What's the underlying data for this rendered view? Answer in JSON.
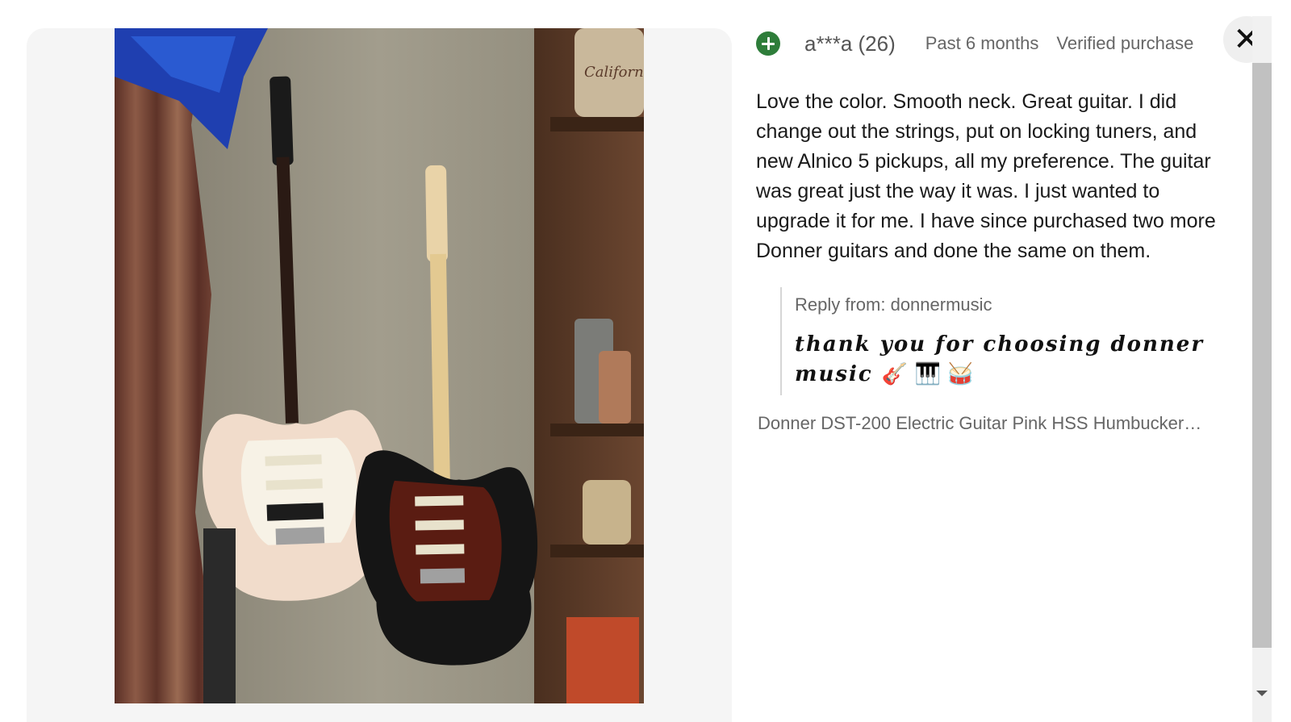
{
  "review": {
    "reviewer": "a***a (26)",
    "time": "Past 6 months",
    "verified": "Verified purchase",
    "text": "Love the color. Smooth neck. Great guitar. I did change out the strings, put on locking tuners, and new Alnico 5 pickups, all my preference. The guitar was great just the way it was. I just wanted to upgrade it for me. I have since purchased two more Donner guitars and done the same on them.",
    "reply_label": "Reply from: donnermusic",
    "reply_text": "thank you for choosing donner music",
    "reply_emojis": "🎸 🎹 🥁",
    "product": "Donner DST-200 Electric Guitar Pink HSS Humbucker…"
  },
  "photo": {
    "description_icon": "review-photo",
    "sign_text": "California"
  },
  "controls": {
    "close_label": "✕"
  },
  "colors": {
    "avatar": "#2e7d3a",
    "accent_text": "#666666"
  }
}
